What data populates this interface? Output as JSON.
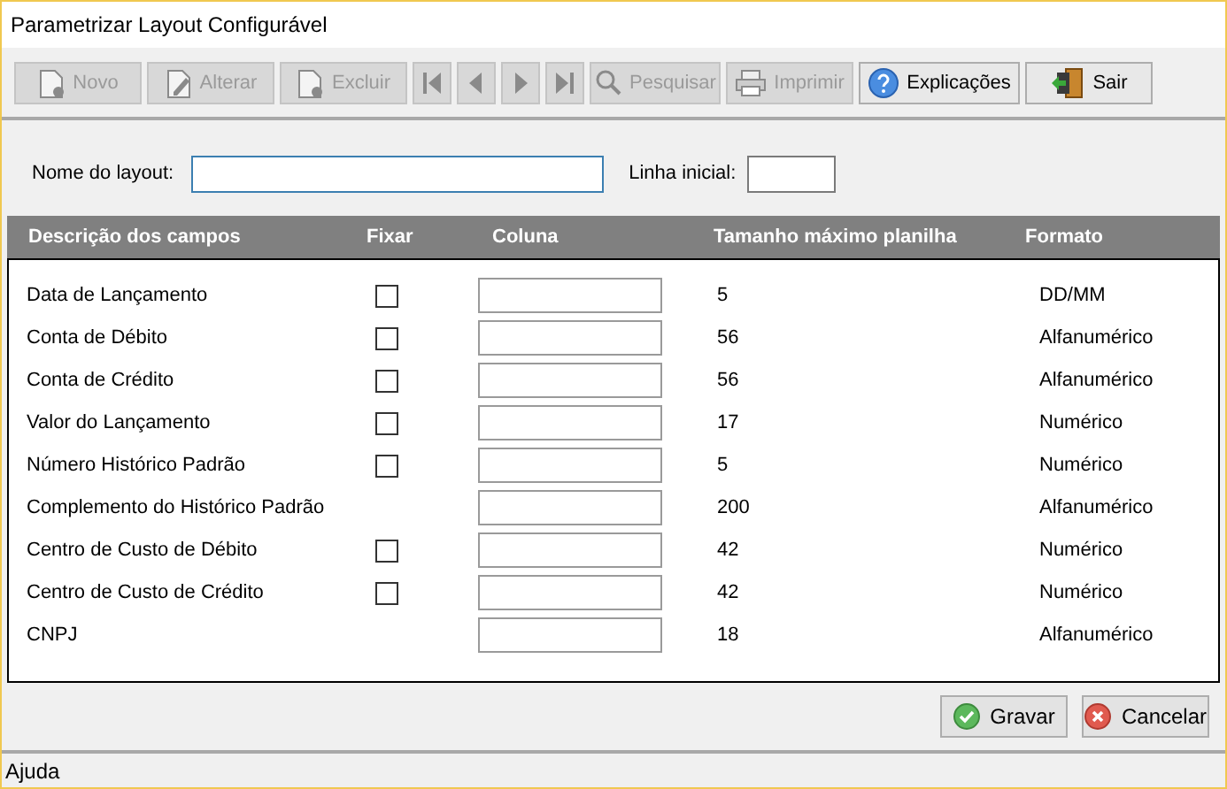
{
  "window": {
    "title": "Parametrizar Layout Configurável"
  },
  "toolbar": [
    {
      "kind": "new",
      "label": "Novo",
      "disabled": true
    },
    {
      "kind": "edit",
      "label": "Alterar",
      "disabled": true
    },
    {
      "kind": "delete",
      "label": "Excluir",
      "disabled": true
    },
    {
      "kind": "first",
      "disabled": true
    },
    {
      "kind": "prev",
      "disabled": true
    },
    {
      "kind": "next",
      "disabled": true
    },
    {
      "kind": "last",
      "disabled": true
    },
    {
      "kind": "search",
      "label": "Pesquisar",
      "disabled": true
    },
    {
      "kind": "print",
      "label": "Imprimir",
      "disabled": true
    },
    {
      "kind": "help",
      "label": "Explicações",
      "disabled": false
    },
    {
      "kind": "exit",
      "label": "Sair",
      "disabled": false
    }
  ],
  "form": {
    "layout_name_label": "Nome do layout:",
    "start_line_label": "Linha inicial:"
  },
  "table": {
    "columns": [
      "Descrição dos campos",
      "Fixar",
      "Coluna",
      "Tamanho máximo planilha",
      "Formato"
    ],
    "rows": [
      {
        "name": "Data de Lançamento",
        "kind": "fixable",
        "checked": false,
        "max_size": "5",
        "format": "DD/MM"
      },
      {
        "name": "Conta de Débito",
        "kind": "fixable",
        "checked": false,
        "max_size": "56",
        "format": "Alfanumérico"
      },
      {
        "name": "Conta de Crédito",
        "kind": "fixable",
        "checked": false,
        "max_size": "56",
        "format": "Alfanumérico"
      },
      {
        "name": "Valor do Lançamento",
        "kind": "fixable",
        "checked": false,
        "max_size": "17",
        "format": "Numérico"
      },
      {
        "name": "Número Histórico Padrão",
        "kind": "fixable",
        "checked": false,
        "max_size": "5",
        "format": "Numérico"
      },
      {
        "name": "Complemento do Histórico Padrão",
        "kind": "plain",
        "max_size": "200",
        "format": "Alfanumérico"
      },
      {
        "name": "Centro de Custo de Débito",
        "kind": "fixable",
        "checked": false,
        "max_size": "42",
        "format": "Numérico"
      },
      {
        "name": "Centro de Custo de Crédito",
        "kind": "fixable",
        "checked": false,
        "max_size": "42",
        "format": "Numérico"
      },
      {
        "name": "CNPJ",
        "kind": "plain",
        "max_size": "18",
        "format": "Alfanumérico"
      }
    ]
  },
  "buttons": [
    {
      "kind": "save",
      "label": "Gravar"
    },
    {
      "kind": "cancel",
      "label": "Cancelar"
    }
  ],
  "status_bar": "Ajuda"
}
